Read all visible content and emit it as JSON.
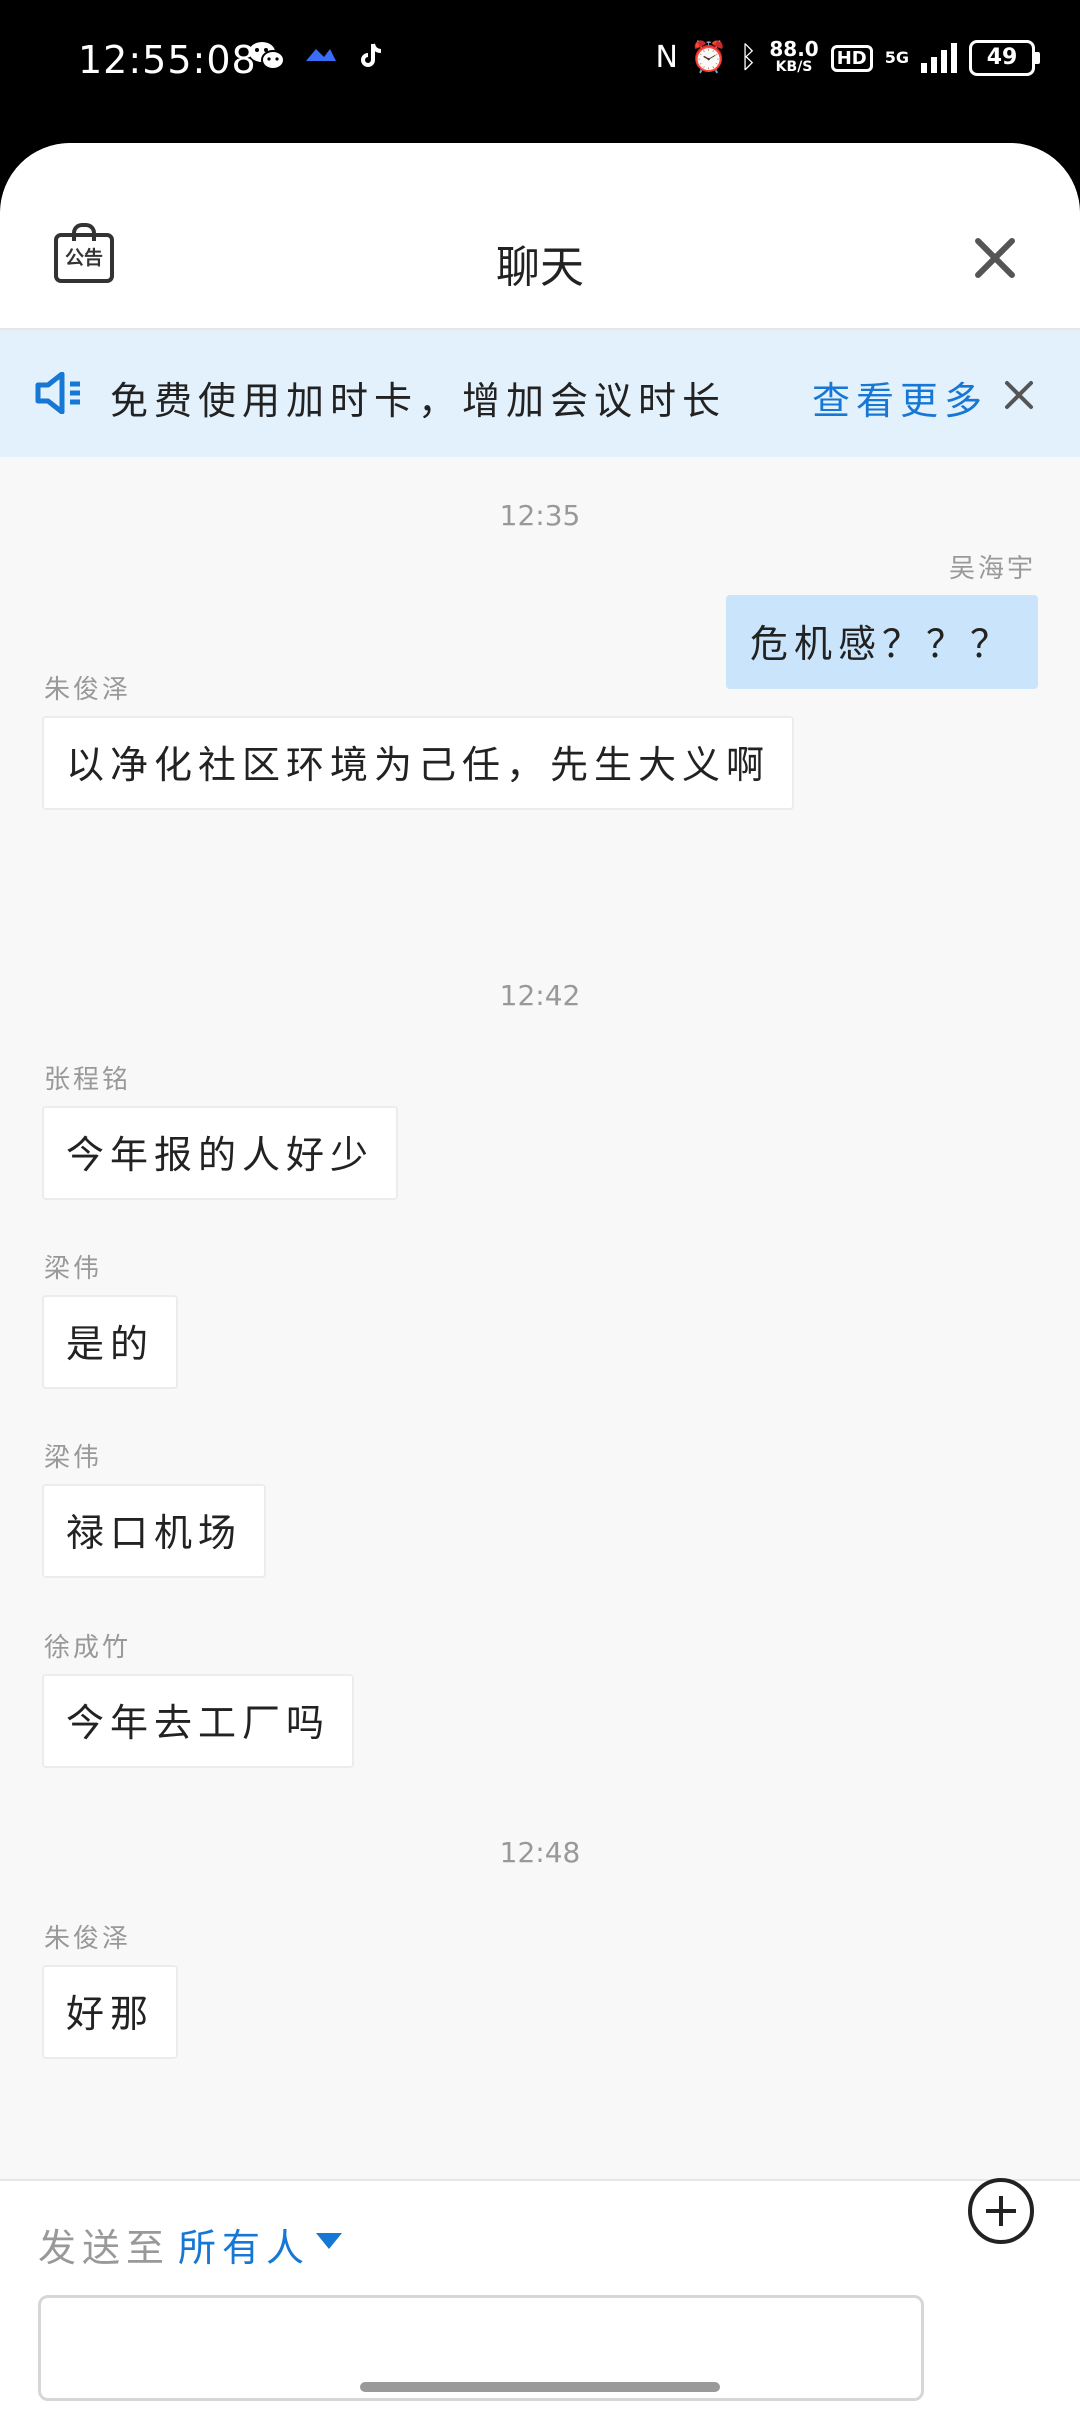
{
  "status_bar": {
    "time": "12:55:08",
    "net_speed_value": "88.0",
    "net_speed_unit": "KB/S",
    "hd_label": "HD",
    "network_type": "5G",
    "battery": "49"
  },
  "header": {
    "notice_icon_text": "公告",
    "title": "聊天"
  },
  "banner": {
    "text": "免费使用加时卡，增加会议时长",
    "more_label": "查看更多"
  },
  "messages": [
    {
      "type": "timestamp",
      "text": "12:35"
    },
    {
      "type": "message",
      "sender": "吴海宇",
      "text": "危机感？？？",
      "self": true
    },
    {
      "type": "message",
      "sender": "朱俊泽",
      "text": "以净化社区环境为己任，先生大义啊",
      "self": false
    },
    {
      "type": "timestamp",
      "text": "12:42"
    },
    {
      "type": "message",
      "sender": "张程铭",
      "text": "今年报的人好少",
      "self": false
    },
    {
      "type": "message",
      "sender": "梁伟",
      "text": "是的",
      "self": false
    },
    {
      "type": "message",
      "sender": "梁伟",
      "text": "禄口机场",
      "self": false
    },
    {
      "type": "message",
      "sender": "徐成竹",
      "text": "今年去工厂吗",
      "self": false
    },
    {
      "type": "timestamp",
      "text": "12:48"
    },
    {
      "type": "message",
      "sender": "朱俊泽",
      "text": "好那",
      "self": false
    }
  ],
  "input": {
    "send_to_label": "发送至",
    "recipient": "所有人",
    "placeholder": ""
  },
  "colors": {
    "accent": "#1677d4",
    "banner_bg": "#e3f1fc",
    "self_bubble": "#c9e4fb",
    "chat_bg": "#f8f8f8"
  }
}
